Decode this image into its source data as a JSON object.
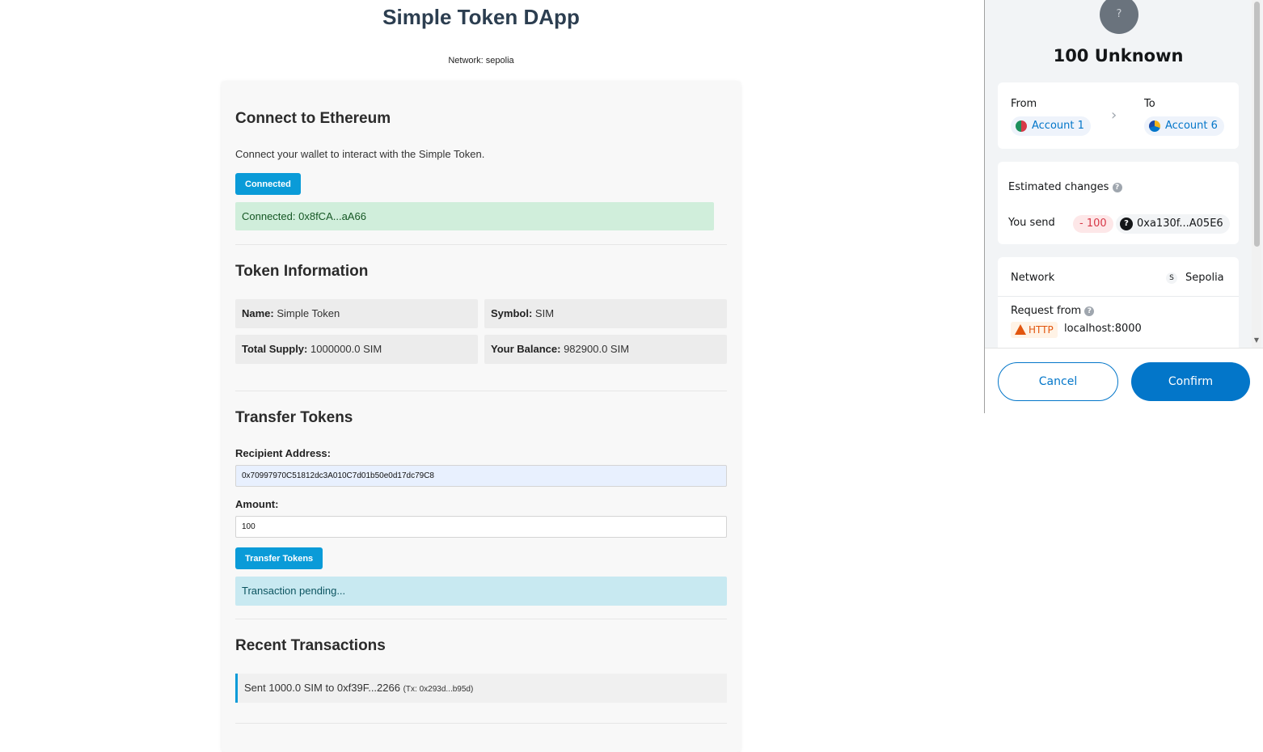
{
  "dapp": {
    "title": "Simple Token DApp",
    "network_line": "Network: sepolia"
  },
  "connect": {
    "heading": "Connect to Ethereum",
    "description": "Connect your wallet to interact with the Simple Token.",
    "button_label": "Connected",
    "status": "Connected: 0x8fCA...aA66"
  },
  "token_info": {
    "heading": "Token Information",
    "name_label": "Name:",
    "name_value": "Simple Token",
    "symbol_label": "Symbol:",
    "symbol_value": "SIM",
    "supply_label": "Total Supply:",
    "supply_value": "1000000.0 SIM",
    "balance_label": "Your Balance:",
    "balance_value": "982900.0 SIM"
  },
  "transfer": {
    "heading": "Transfer Tokens",
    "recipient_label": "Recipient Address:",
    "recipient_value": "0x70997970C51812dc3A010C7d01b50e0d17dc79C8",
    "amount_label": "Amount:",
    "amount_value": "100",
    "button_label": "Transfer Tokens",
    "status": "Transaction pending..."
  },
  "recent": {
    "heading": "Recent Transactions",
    "items": [
      {
        "text": "Sent 1000.0 SIM to 0xf39F...2266",
        "tx": "(Tx: 0x293d...b95d)"
      }
    ]
  },
  "wallet": {
    "token_icon": "?",
    "amount_title": "100 Unknown",
    "from_label": "From",
    "to_label": "To",
    "from_account": "Account 1",
    "to_account": "Account 6",
    "estimated_label": "Estimated changes",
    "you_send_label": "You send",
    "send_amount": "- 100",
    "send_address": "0xa130f...A05E6",
    "network_label": "Network",
    "network_badge": "S",
    "network_value": "Sepolia",
    "request_label": "Request from",
    "http_label": "HTTP",
    "request_origin": "localhost:8000",
    "cancel_label": "Cancel",
    "confirm_label": "Confirm",
    "colors": {
      "primary": "#0376c9",
      "danger": "#d73847",
      "warning": "#e2560f"
    }
  },
  "colors": {
    "button": "#0a9bd8",
    "success_bg": "#d0eedb",
    "info_bg": "#c8e9f1"
  }
}
